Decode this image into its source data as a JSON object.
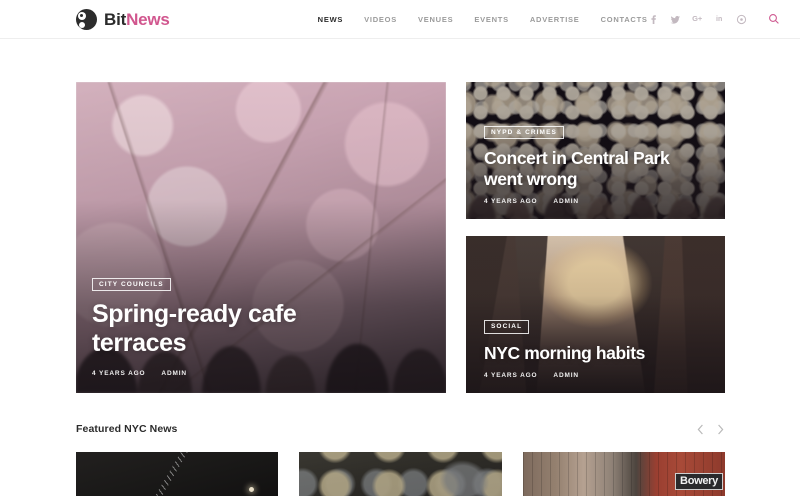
{
  "site": {
    "logo_first": "Bit",
    "logo_second": "News",
    "logo_icon": "panda-circle-logo",
    "accent_color": "#d1568e",
    "text_color": "#2b2b2b"
  },
  "nav": {
    "items": [
      {
        "label": "NEWS",
        "active": true
      },
      {
        "label": "VIDEOS",
        "active": false
      },
      {
        "label": "VENUES",
        "active": false
      },
      {
        "label": "EVENTS",
        "active": false
      },
      {
        "label": "ADVERTISE",
        "active": false
      },
      {
        "label": "CONTACTS",
        "active": false
      }
    ]
  },
  "social": {
    "items": [
      {
        "name": "facebook-icon",
        "glyph": "f"
      },
      {
        "name": "twitter-icon",
        "glyph": "t"
      },
      {
        "name": "google-plus-icon",
        "glyph": "G+"
      },
      {
        "name": "linkedin-icon",
        "glyph": "in"
      },
      {
        "name": "pinterest-icon",
        "glyph": "o"
      }
    ],
    "search_icon": "search-icon"
  },
  "hero": {
    "main": {
      "badge": "CITY COUNCILS",
      "title": "Spring-ready cafe terraces",
      "time": "4 YEARS AGO",
      "author": "ADMIN",
      "image": "cherry-blossom-street-crowd"
    },
    "secondary": [
      {
        "badge": "NYPD & CRIMES",
        "title": "Concert in Central Park went wrong",
        "time": "4 YEARS AGO",
        "author": "ADMIN",
        "image": "night-concert-crowd-lights"
      },
      {
        "badge": "SOCIAL",
        "title": "NYC morning habits",
        "time": "4 YEARS AGO",
        "author": "ADMIN",
        "image": "nyc-street-sunrise"
      }
    ]
  },
  "featured": {
    "title": "Featured NYC News",
    "prev_icon": "chevron-left-icon",
    "next_icon": "chevron-right-icon",
    "thumbs": [
      {
        "image": "night-crane-construction"
      },
      {
        "image": "dark-night-scene"
      },
      {
        "image": "bowery-brick-storefront",
        "sign_text": "Bowery"
      }
    ]
  }
}
